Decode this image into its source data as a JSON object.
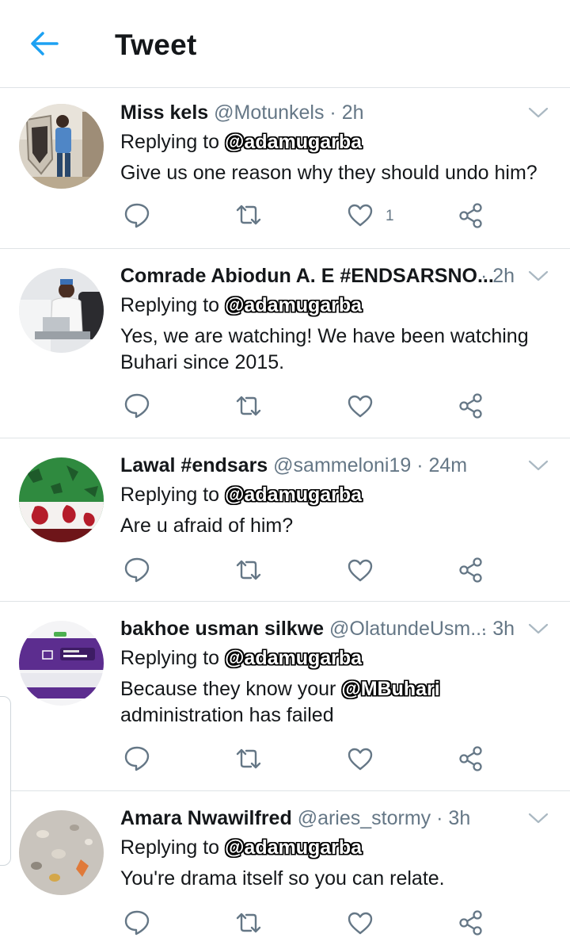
{
  "header": {
    "title": "Tweet",
    "back_icon": "arrow-left-icon",
    "accent": "#1da1f2"
  },
  "colors": {
    "text": "#14171a",
    "muted": "#657786",
    "divider": "#dfe3e6",
    "icon": "#657786"
  },
  "tweets": [
    {
      "name": "Miss kels",
      "handle": "@Motunkels",
      "time": "· 2h",
      "replying_label": "Replying to",
      "mention": "@adamugarba",
      "body_lines": [
        "Give us one reason why they should undo him?"
      ],
      "like_count": "1"
    },
    {
      "name": "Comrade Abiodun A. E #ENDSARSNO...",
      "handle": "",
      "time": "· 2h",
      "replying_label": "Replying to",
      "mention": "@adamugarba",
      "body_lines": [
        "Yes, we are watching! We have been watching",
        "Buhari since 2015."
      ],
      "like_count": ""
    },
    {
      "name": "Lawal #endsars",
      "handle": "@sammeloni19",
      "time": "· 24m",
      "replying_label": "Replying to",
      "mention": "@adamugarba",
      "body_lines": [
        "Are u afraid of him?"
      ],
      "like_count": ""
    },
    {
      "name": "bakhoe usman silkwe",
      "handle": "@OlatundeUsm...",
      "time": "· 3h",
      "replying_label": "Replying to",
      "mention": "@adamugarba",
      "body_pre": "Because they know your",
      "body_mention": "@MBuhari",
      "body_line2": "administration has failed",
      "like_count": ""
    },
    {
      "name": "Amara Nwawilfred",
      "handle": "@aries_stormy",
      "time": "· 3h",
      "replying_label": "Replying to",
      "mention": "@adamugarba",
      "body_lines": [
        "You're drama itself so you can relate."
      ],
      "like_count": ""
    }
  ],
  "icons": [
    "reply-icon",
    "retweet-icon",
    "like-icon",
    "share-icon",
    "caret-down-icon"
  ]
}
